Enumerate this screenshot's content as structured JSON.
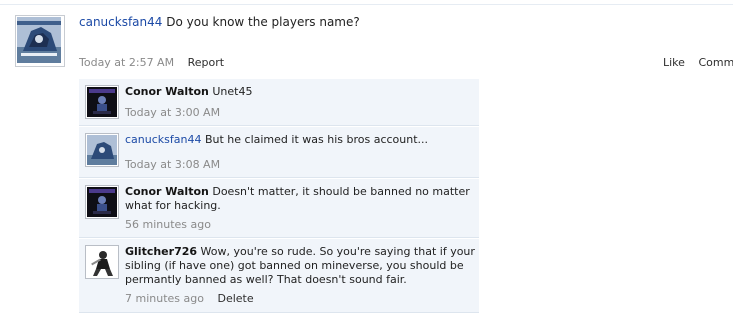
{
  "post": {
    "author": "canucksfan44",
    "text": "Do you know the players name?",
    "timestamp": "Today at 2:57 AM",
    "report_label": "Report",
    "like_label": "Like",
    "comment_label": "Comment",
    "avatar": "hockey-logo-avatar"
  },
  "comments": [
    {
      "author": "Conor Walton",
      "text": "Unet45",
      "timestamp": "Today at 3:00 AM",
      "avatar": "dark-character-avatar"
    },
    {
      "author": "canucksfan44",
      "text": "But he claimed it was his bros account...",
      "timestamp": "Today at 3:08 AM",
      "avatar": "hockey-logo-avatar"
    },
    {
      "author": "Conor Walton",
      "text": "Doesn't matter, it should be banned no matter what for hacking.",
      "timestamp": "56 minutes ago",
      "avatar": "dark-character-avatar"
    },
    {
      "author": "Glitcher726",
      "text": "Wow, you're so rude. So you're saying that if your sibling (if have one) got banned on mineverse, you should be permantly banned as well? That doesn't sound fair.",
      "timestamp": "7 minutes ago",
      "delete_label": "Delete",
      "avatar": "ninja-character-avatar"
    }
  ],
  "colors": {
    "link_blue": "#1c4aa6",
    "comment_bg": "#f1f5fa",
    "meta_gray": "#8a8a8a"
  }
}
